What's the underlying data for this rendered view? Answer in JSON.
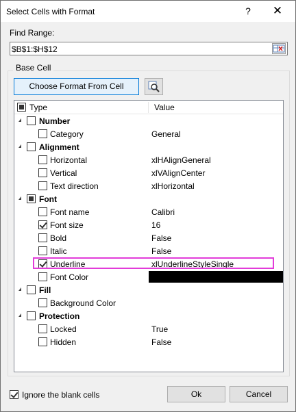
{
  "window": {
    "title": "Select Cells with Format",
    "help_glyph": "?",
    "close_glyph": "✕"
  },
  "find_range": {
    "label": "Find Range:",
    "value": "$B$1:$H$12"
  },
  "base_cell": {
    "label": "Base Cell",
    "choose_button": "Choose Format From Cell"
  },
  "tree": {
    "header": {
      "type": "Type",
      "value": "Value"
    },
    "rows": [
      {
        "name": "Number",
        "value": "",
        "group": true
      },
      {
        "name": "Category",
        "value": "General",
        "group": false
      },
      {
        "name": "Alignment",
        "value": "",
        "group": true
      },
      {
        "name": "Horizontal",
        "value": "xlHAlignGeneral",
        "group": false
      },
      {
        "name": "Vertical",
        "value": "xlVAlignCenter",
        "group": false
      },
      {
        "name": "Text direction",
        "value": "xlHorizontal",
        "group": false
      },
      {
        "name": "Font",
        "value": "",
        "group": true
      },
      {
        "name": "Font name",
        "value": "Calibri",
        "group": false
      },
      {
        "name": "Font size",
        "value": "16",
        "group": false
      },
      {
        "name": "Bold",
        "value": "False",
        "group": false
      },
      {
        "name": "Italic",
        "value": "False",
        "group": false
      },
      {
        "name": "Underline",
        "value": "xlUnderlineStyleSingle",
        "group": false
      },
      {
        "name": "Font Color",
        "value": "",
        "group": false
      },
      {
        "name": "Fill",
        "value": "",
        "group": true
      },
      {
        "name": "Background Color",
        "value": "",
        "group": false
      },
      {
        "name": "Protection",
        "value": "",
        "group": true
      },
      {
        "name": "Locked",
        "value": "True",
        "group": false
      },
      {
        "name": "Hidden",
        "value": "False",
        "group": false
      }
    ]
  },
  "footer": {
    "ignore_blank_label": "Ignore the blank cells",
    "ok": "Ok",
    "cancel": "Cancel"
  },
  "colors": {
    "highlight": "#e23cd9",
    "accent_border": "#0078d7",
    "swatch": "#000000"
  }
}
